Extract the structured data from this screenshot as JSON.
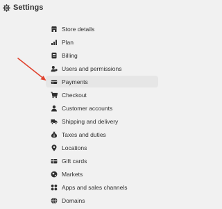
{
  "header": {
    "title": "Settings",
    "icon": "gear-icon"
  },
  "nav": {
    "items": [
      {
        "label": "Store details",
        "icon": "store-icon"
      },
      {
        "label": "Plan",
        "icon": "plan-chart-icon"
      },
      {
        "label": "Billing",
        "icon": "billing-receipt-icon"
      },
      {
        "label": "Users and permissions",
        "icon": "users-icon"
      },
      {
        "label": "Payments",
        "icon": "payments-icon",
        "active": true
      },
      {
        "label": "Checkout",
        "icon": "cart-icon"
      },
      {
        "label": "Customer accounts",
        "icon": "person-icon"
      },
      {
        "label": "Shipping and delivery",
        "icon": "truck-icon"
      },
      {
        "label": "Taxes and duties",
        "icon": "tax-bag-icon"
      },
      {
        "label": "Locations",
        "icon": "location-pin-icon"
      },
      {
        "label": "Gift cards",
        "icon": "gift-card-icon"
      },
      {
        "label": "Markets",
        "icon": "markets-globe-icon"
      },
      {
        "label": "Apps and sales channels",
        "icon": "apps-icon"
      },
      {
        "label": "Domains",
        "icon": "domains-globe-icon"
      }
    ]
  },
  "annotation": {
    "arrow_color": "#e0432f",
    "icon": "red-arrow-annotation"
  },
  "colors": {
    "background": "#f1f1f1",
    "active_item": "#e6e6e6",
    "text": "#303030"
  }
}
